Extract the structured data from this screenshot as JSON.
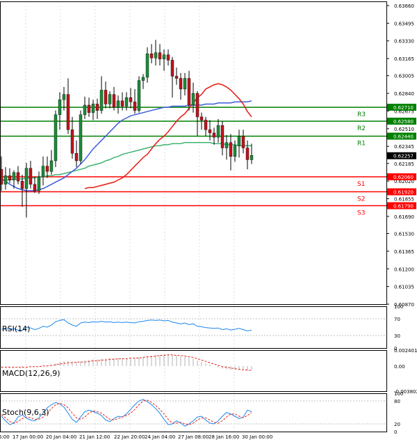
{
  "chart_data": [
    {
      "type": "candlestick",
      "panel": "price",
      "price_ticks": [
        "0.63660",
        "0.63495",
        "0.63330",
        "0.63165",
        "0.63005",
        "0.62840",
        "0.62675",
        "0.62510",
        "0.62345",
        "0.62185",
        "0.62020",
        "0.61855",
        "0.61690",
        "0.61530",
        "0.61365",
        "0.61200",
        "0.61035",
        "0.60870"
      ],
      "ylim": [
        0.6087,
        0.6366
      ],
      "current_price": "0.62257",
      "x_ticks": [
        "6:00",
        "17 Jan 00:00",
        "20 Jan 04:00",
        "21 Jan 12:00",
        "22 Jan 20:00",
        "24 Jan 04:00",
        "27 Jan 08:00",
        "28 Jan 16:00",
        "30 Jan 00:00"
      ],
      "pivot_levels": [
        {
          "label": "R3",
          "value": "0.62710",
          "color": "#008000"
        },
        {
          "label": "R2",
          "value": "0.62580",
          "color": "#008000"
        },
        {
          "label": "R1",
          "value": "0.62440",
          "color": "#008000"
        },
        {
          "label": "S1",
          "value": "0.62060",
          "color": "#ff0000"
        },
        {
          "label": "S2",
          "value": "0.61920",
          "color": "#ff0000"
        },
        {
          "label": "S3",
          "value": "0.61790",
          "color": "#ff0000"
        }
      ],
      "candles": [
        [
          0.6213,
          0.6225,
          0.6193,
          0.6199
        ],
        [
          0.6199,
          0.6215,
          0.6194,
          0.6207
        ],
        [
          0.6207,
          0.6214,
          0.62,
          0.6203
        ],
        [
          0.6203,
          0.6212,
          0.6195,
          0.621
        ],
        [
          0.621,
          0.6216,
          0.6199,
          0.6202
        ],
        [
          0.6202,
          0.6208,
          0.6178,
          0.6195
        ],
        [
          0.6195,
          0.6219,
          0.6168,
          0.6214
        ],
        [
          0.6214,
          0.6221,
          0.6195,
          0.6199
        ],
        [
          0.6199,
          0.6206,
          0.6191,
          0.6193
        ],
        [
          0.6193,
          0.6211,
          0.619,
          0.6206
        ],
        [
          0.6206,
          0.6225,
          0.6198,
          0.6216
        ],
        [
          0.6216,
          0.6225,
          0.6205,
          0.6211
        ],
        [
          0.6211,
          0.6231,
          0.6208,
          0.6221
        ],
        [
          0.6221,
          0.6268,
          0.6215,
          0.6264
        ],
        [
          0.6264,
          0.6285,
          0.625,
          0.6278
        ],
        [
          0.6278,
          0.629,
          0.6268,
          0.6283
        ],
        [
          0.6283,
          0.6298,
          0.6246,
          0.625
        ],
        [
          0.625,
          0.6262,
          0.6223,
          0.6228
        ],
        [
          0.6228,
          0.624,
          0.6215,
          0.6221
        ],
        [
          0.6221,
          0.6268,
          0.6218,
          0.6264
        ],
        [
          0.6264,
          0.6281,
          0.626,
          0.6273
        ],
        [
          0.6273,
          0.628,
          0.6262,
          0.6266
        ],
        [
          0.6266,
          0.6278,
          0.6259,
          0.6274
        ],
        [
          0.6274,
          0.6279,
          0.626,
          0.6268
        ],
        [
          0.6268,
          0.63,
          0.6265,
          0.6287
        ],
        [
          0.6287,
          0.6295,
          0.627,
          0.6274
        ],
        [
          0.6274,
          0.6286,
          0.627,
          0.6283
        ],
        [
          0.6283,
          0.629,
          0.6268,
          0.6271
        ],
        [
          0.6271,
          0.6282,
          0.6265,
          0.6277
        ],
        [
          0.6277,
          0.6285,
          0.6268,
          0.6272
        ],
        [
          0.6272,
          0.6285,
          0.6268,
          0.628
        ],
        [
          0.628,
          0.6289,
          0.627,
          0.6276
        ],
        [
          0.6276,
          0.6288,
          0.6265,
          0.6268
        ],
        [
          0.6268,
          0.63,
          0.6266,
          0.6296
        ],
        [
          0.6296,
          0.6302,
          0.6288,
          0.6299
        ],
        [
          0.6299,
          0.6327,
          0.6294,
          0.6321
        ],
        [
          0.6321,
          0.633,
          0.6312,
          0.6317
        ],
        [
          0.6317,
          0.6334,
          0.631,
          0.6322
        ],
        [
          0.6322,
          0.633,
          0.631,
          0.6316
        ],
        [
          0.6316,
          0.6325,
          0.6305,
          0.632
        ],
        [
          0.632,
          0.6325,
          0.631,
          0.6315
        ],
        [
          0.6315,
          0.6318,
          0.628,
          0.63
        ],
        [
          0.63,
          0.6308,
          0.6292,
          0.6298
        ],
        [
          0.6298,
          0.6303,
          0.6278,
          0.6288
        ],
        [
          0.6288,
          0.6303,
          0.6282,
          0.6298
        ],
        [
          0.6298,
          0.6305,
          0.6268,
          0.6273
        ],
        [
          0.6273,
          0.6294,
          0.6266,
          0.6284
        ],
        [
          0.6284,
          0.6286,
          0.6244,
          0.6262
        ],
        [
          0.6262,
          0.6266,
          0.625,
          0.6259
        ],
        [
          0.6259,
          0.6262,
          0.6244,
          0.625
        ],
        [
          0.625,
          0.6259,
          0.624,
          0.6247
        ],
        [
          0.6247,
          0.6252,
          0.6236,
          0.6243
        ],
        [
          0.6243,
          0.626,
          0.6238,
          0.6254
        ],
        [
          0.6254,
          0.6258,
          0.6226,
          0.6233
        ],
        [
          0.6233,
          0.6245,
          0.6222,
          0.6238
        ],
        [
          0.6238,
          0.6246,
          0.6212,
          0.6225
        ],
        [
          0.6225,
          0.624,
          0.622,
          0.6235
        ],
        [
          0.6235,
          0.625,
          0.6224,
          0.6244
        ],
        [
          0.6244,
          0.625,
          0.6228,
          0.6233
        ],
        [
          0.6233,
          0.624,
          0.6213,
          0.6222
        ],
        [
          0.6222,
          0.6237,
          0.6218,
          0.6226
        ]
      ],
      "ma_fast": [
        0.6195,
        0.6196,
        0.6196,
        0.6197,
        0.6198,
        0.6199,
        0.62,
        0.6201,
        0.6203,
        0.6205,
        0.6208,
        0.6212,
        0.6216,
        0.622,
        0.6224,
        0.6227,
        0.6232,
        0.6237,
        0.6241,
        0.6244,
        0.6248,
        0.6253,
        0.6258,
        0.6262,
        0.6265,
        0.627,
        0.6275,
        0.628,
        0.6283,
        0.6288,
        0.629,
        0.6292,
        0.6293,
        0.6292,
        0.629,
        0.6287,
        0.6283,
        0.6279,
        0.6274,
        0.6267,
        0.6262
      ],
      "ma_fast_start": 20,
      "ma_mid": [
        0.6204,
        0.6202,
        0.6199,
        0.6197,
        0.6195,
        0.6194,
        0.6193,
        0.6193,
        0.6193,
        0.6194,
        0.6195,
        0.6197,
        0.6199,
        0.6201,
        0.6203,
        0.6205,
        0.6208,
        0.6211,
        0.6214,
        0.6218,
        0.6222,
        0.6227,
        0.6232,
        0.6236,
        0.624,
        0.6244,
        0.6248,
        0.6252,
        0.6256,
        0.6259,
        0.6261,
        0.6263,
        0.6264,
        0.6265,
        0.6266,
        0.6267,
        0.6268,
        0.6269,
        0.627,
        0.6271,
        0.6271,
        0.6272,
        0.6272,
        0.6272,
        0.6272,
        0.6273,
        0.6273,
        0.6273,
        0.6273,
        0.6274,
        0.6274,
        0.6274,
        0.6275,
        0.6275,
        0.6275,
        0.6275,
        0.6276,
        0.6276,
        0.6276,
        0.6276,
        0.6277
      ],
      "ma_slow": [
        0.6203,
        0.6203,
        0.6203,
        0.6204,
        0.6204,
        0.6204,
        0.6205,
        0.6205,
        0.6205,
        0.6206,
        0.6206,
        0.6207,
        0.6207,
        0.6208,
        0.6208,
        0.6209,
        0.621,
        0.6211,
        0.6212,
        0.6213,
        0.6214,
        0.6216,
        0.6217,
        0.6218,
        0.6219,
        0.6221,
        0.6222,
        0.6224,
        0.6225,
        0.6227,
        0.6228,
        0.6229,
        0.623,
        0.6231,
        0.6232,
        0.6233,
        0.6234,
        0.6235,
        0.6235,
        0.6236,
        0.6236,
        0.6237,
        0.6237,
        0.6237,
        0.6238,
        0.6238,
        0.6238,
        0.6238,
        0.6238,
        0.6238,
        0.6238,
        0.6237,
        0.6237,
        0.6237,
        0.6236,
        0.6236,
        0.6236,
        0.6235,
        0.6235,
        0.6235,
        0.6235
      ]
    },
    {
      "type": "line",
      "panel": "rsi",
      "label": "RSI(14)",
      "y_ticks": [
        "100",
        "70",
        "30",
        "0"
      ],
      "ylim": [
        0,
        100
      ],
      "values": [
        45,
        47,
        44,
        46,
        43,
        42,
        50,
        48,
        44,
        47,
        52,
        50,
        55,
        63,
        66,
        68,
        60,
        55,
        52,
        60,
        62,
        61,
        63,
        62,
        64,
        62,
        63,
        61,
        62,
        61,
        62,
        61,
        60,
        63,
        64,
        66,
        67,
        66,
        67,
        65,
        66,
        62,
        60,
        58,
        60,
        56,
        58,
        52,
        51,
        49,
        48,
        47,
        48,
        44,
        46,
        43,
        45,
        47,
        44,
        41,
        43
      ]
    },
    {
      "type": "bar",
      "panel": "macd",
      "label": "MACD(12,26,9)",
      "y_ticks": [
        "0.002401",
        "0.00",
        "-0.003802"
      ],
      "ylim": [
        -0.0038,
        0.0024
      ],
      "hist": [
        -0.0002,
        -0.0002,
        -0.0002,
        -0.0002,
        -0.0002,
        -0.0002,
        -0.0001,
        -0.0001,
        -0.0001,
        0.0,
        0.0001,
        0.0001,
        0.0002,
        0.0004,
        0.0006,
        0.0007,
        0.0007,
        0.0007,
        0.0006,
        0.0007,
        0.0008,
        0.0009,
        0.001,
        0.001,
        0.0011,
        0.0011,
        0.0012,
        0.0012,
        0.0012,
        0.0012,
        0.0012,
        0.0012,
        0.0012,
        0.0013,
        0.0014,
        0.0015,
        0.0016,
        0.0017,
        0.0017,
        0.0018,
        0.0018,
        0.0017,
        0.0016,
        0.0015,
        0.0014,
        0.0012,
        0.0011,
        0.0008,
        0.0006,
        0.0004,
        0.0002,
        0.0,
        -0.0002,
        -0.0004,
        -0.0005,
        -0.0006,
        -0.0006,
        -0.0006,
        -0.0006,
        -0.0007,
        -0.0007
      ],
      "signal": [
        -0.0002,
        -0.0002,
        -0.0002,
        -0.0002,
        -0.0002,
        -0.0002,
        -0.0002,
        -0.0001,
        -0.0001,
        -0.0001,
        0.0,
        0.0,
        0.0001,
        0.0002,
        0.0003,
        0.0004,
        0.0005,
        0.0005,
        0.0006,
        0.0006,
        0.0006,
        0.0007,
        0.0008,
        0.0008,
        0.0009,
        0.0009,
        0.001,
        0.001,
        0.0011,
        0.0011,
        0.0011,
        0.0012,
        0.0012,
        0.0012,
        0.0013,
        0.0014,
        0.0014,
        0.0015,
        0.0016,
        0.0016,
        0.0017,
        0.0017,
        0.0016,
        0.0016,
        0.0015,
        0.0014,
        0.0013,
        0.0011,
        0.0009,
        0.0007,
        0.0005,
        0.0003,
        0.0001,
        -0.0001,
        -0.0002,
        -0.0003,
        -0.0004,
        -0.0005,
        -0.0006,
        -0.0006,
        -0.0007
      ]
    },
    {
      "type": "line",
      "panel": "stoch",
      "label": "Stoch(9,6,3)",
      "y_ticks": [
        "100",
        "80",
        "20",
        "0"
      ],
      "ylim": [
        0,
        100
      ],
      "k": [
        40,
        28,
        18,
        22,
        38,
        44,
        35,
        30,
        28,
        36,
        48,
        62,
        70,
        76,
        72,
        64,
        48,
        32,
        24,
        38,
        52,
        56,
        52,
        48,
        42,
        30,
        26,
        34,
        40,
        38,
        46,
        58,
        70,
        80,
        84,
        78,
        70,
        60,
        48,
        32,
        18,
        20,
        28,
        22,
        14,
        20,
        28,
        38,
        40,
        30,
        22,
        20,
        28,
        40,
        50,
        46,
        40,
        34,
        38,
        56,
        52
      ],
      "d": [
        44,
        36,
        26,
        22,
        26,
        34,
        38,
        36,
        32,
        32,
        38,
        48,
        60,
        70,
        74,
        70,
        62,
        48,
        36,
        32,
        38,
        48,
        54,
        52,
        48,
        40,
        32,
        30,
        34,
        38,
        42,
        48,
        58,
        70,
        80,
        82,
        76,
        68,
        58,
        46,
        32,
        22,
        22,
        24,
        20,
        18,
        22,
        30,
        36,
        36,
        30,
        24,
        22,
        28,
        38,
        46,
        46,
        40,
        36,
        42,
        50
      ]
    }
  ]
}
